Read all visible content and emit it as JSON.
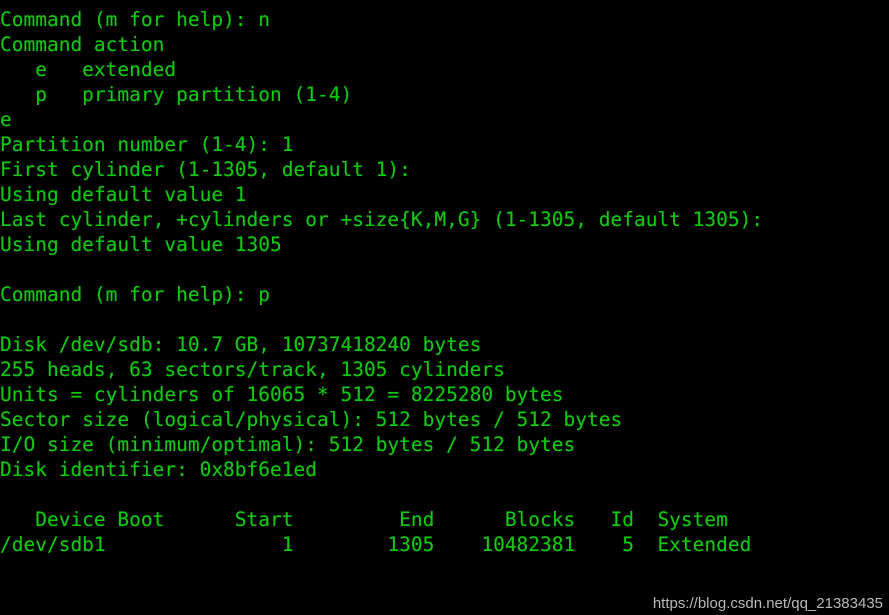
{
  "terminal": {
    "program": "fdisk",
    "device": "/dev/sdb",
    "foreground_color": "#13c713",
    "background_color": "#000000",
    "columns": 72,
    "lines": [
      "Command (m for help): n",
      "Command action",
      "   e   extended",
      "   p   primary partition (1-4)",
      "e",
      "Partition number (1-4): 1",
      "First cylinder (1-1305, default 1): ",
      "Using default value 1",
      "Last cylinder, +cylinders or +size{K,M,G} (1-1305, default 1305): ",
      "Using default value 1305",
      "",
      "Command (m for help): p",
      "",
      "Disk /dev/sdb: 10.7 GB, 10737418240 bytes",
      "255 heads, 63 sectors/track, 1305 cylinders",
      "Units = cylinders of 16065 * 512 = 8225280 bytes",
      "Sector size (logical/physical): 512 bytes / 512 bytes",
      "I/O size (minimum/optimal): 512 bytes / 512 bytes",
      "Disk identifier: 0x8bf6e1ed",
      "",
      "   Device Boot      Start         End      Blocks   Id  System",
      "/dev/sdb1               1        1305    10482381    5  Extended"
    ],
    "prompts": {
      "command_prompt": "Command (m for help): ",
      "first_command_input": "n",
      "second_command_input": "p",
      "partition_type_input": "e",
      "partition_number_input": "1"
    },
    "command_action_menu": [
      {
        "key": "e",
        "label": "extended"
      },
      {
        "key": "p",
        "label": "primary partition (1-4)"
      }
    ],
    "disk_info": {
      "disk_label": "Disk /dev/sdb: 10.7 GB, 10737418240 bytes",
      "size_human": "10.7 GB",
      "size_bytes": "10737418240",
      "heads": "255",
      "sectors_per_track": "63",
      "cylinders": "1305",
      "unit_bytes": "8225280",
      "unit_sectors": "16065",
      "sector_size_logical": "512 bytes",
      "sector_size_physical": "512 bytes",
      "io_size_minimum": "512 bytes",
      "io_size_optimal": "512 bytes",
      "identifier": "0x8bf6e1ed"
    },
    "partition_table": {
      "headers": [
        "Device Boot",
        "Start",
        "End",
        "Blocks",
        "Id",
        "System"
      ],
      "rows": [
        {
          "device": "/dev/sdb1",
          "boot": "",
          "start": "1",
          "end": "1305",
          "blocks": "10482381",
          "id": "5",
          "system": "Extended"
        }
      ]
    }
  },
  "watermark": {
    "text": "https://blog.csdn.net/qq_21383435"
  }
}
